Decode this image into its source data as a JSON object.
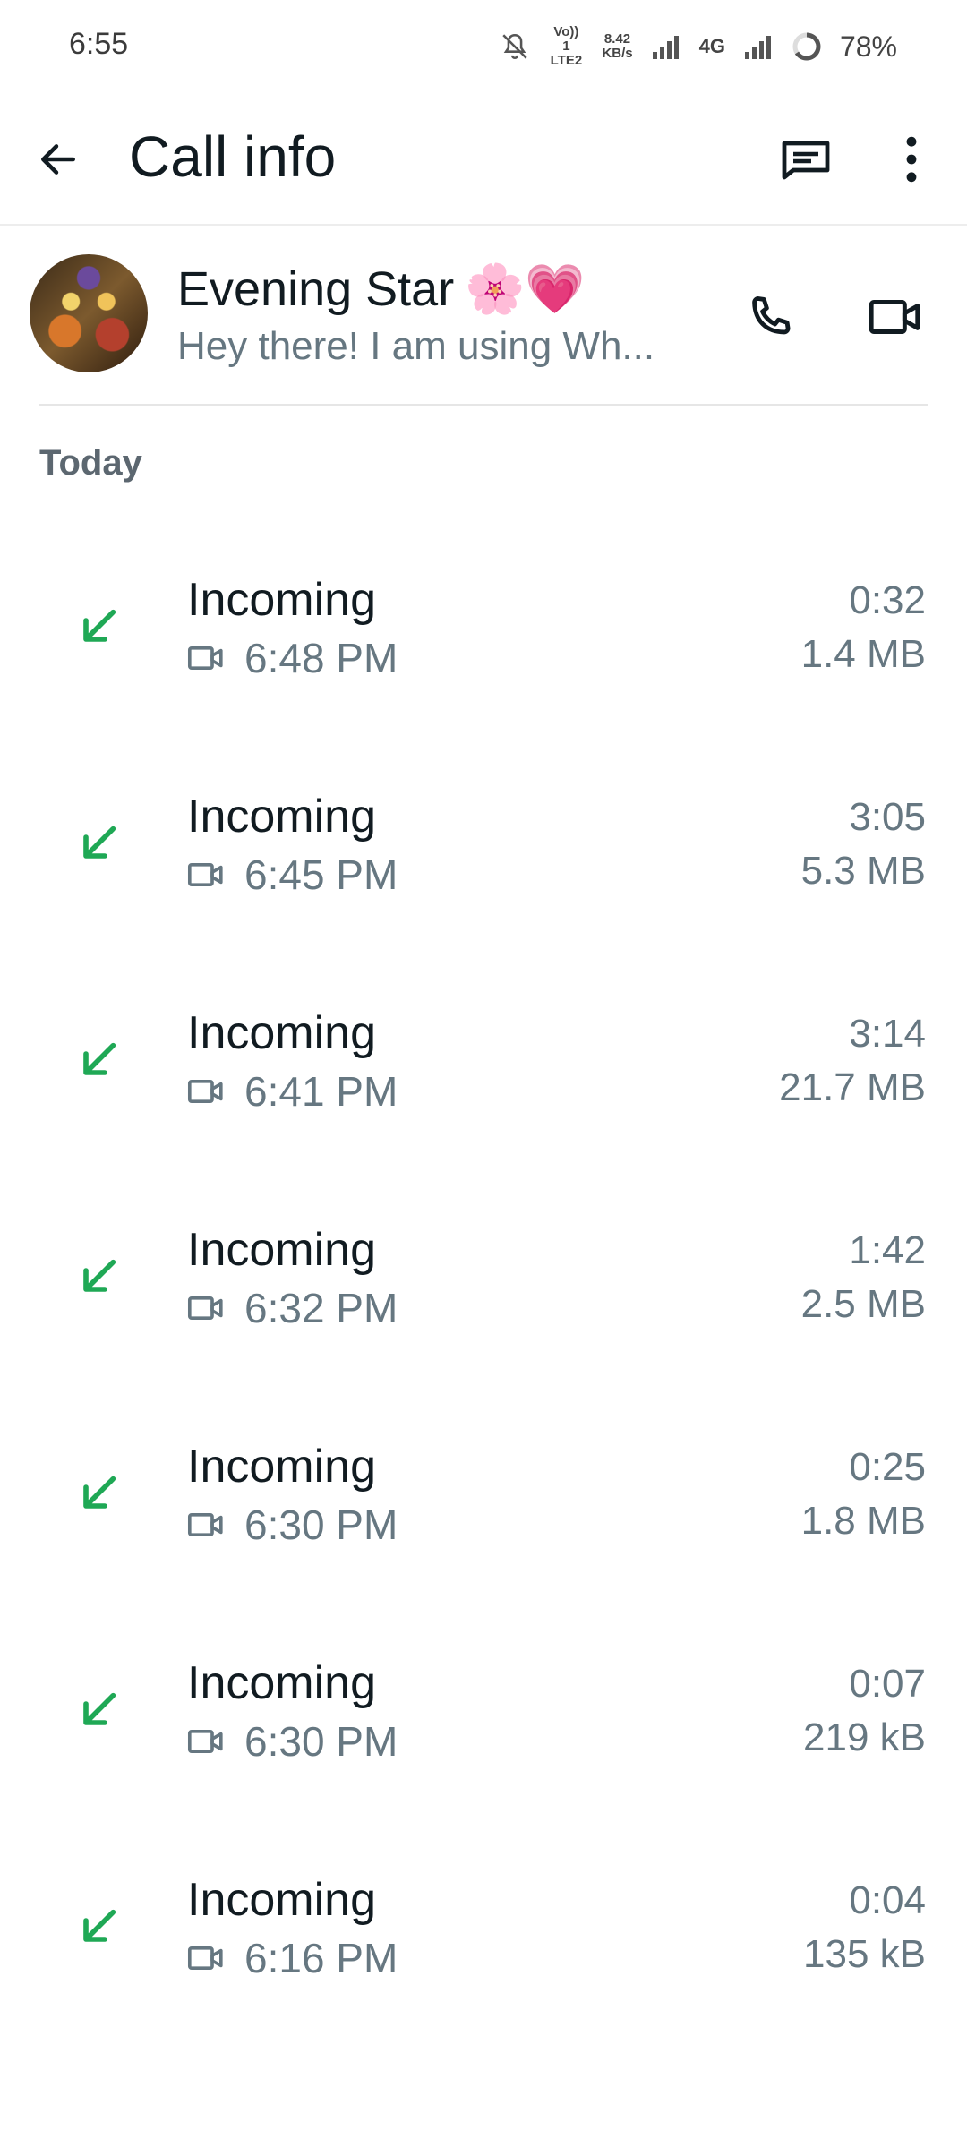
{
  "status_bar": {
    "time": "6:55",
    "volte_label": "Vo)) 1 LTE2",
    "speed_value": "8.42",
    "speed_unit": "KB/s",
    "network": "4G",
    "battery": "78%"
  },
  "app_bar": {
    "title": "Call info"
  },
  "contact": {
    "name": "Evening Star",
    "emoji": "🌸💗",
    "status": "Hey there! I am using Wh..."
  },
  "section": {
    "title": "Today"
  },
  "colors": {
    "accent_green": "#1fa855",
    "text_primary": "#111b21",
    "text_secondary": "#667781"
  },
  "calls": [
    {
      "type": "Incoming",
      "time": "6:48 PM",
      "duration": "0:32",
      "size": "1.4 MB"
    },
    {
      "type": "Incoming",
      "time": "6:45 PM",
      "duration": "3:05",
      "size": "5.3 MB"
    },
    {
      "type": "Incoming",
      "time": "6:41 PM",
      "duration": "3:14",
      "size": "21.7 MB"
    },
    {
      "type": "Incoming",
      "time": "6:32 PM",
      "duration": "1:42",
      "size": "2.5 MB"
    },
    {
      "type": "Incoming",
      "time": "6:30 PM",
      "duration": "0:25",
      "size": "1.8 MB"
    },
    {
      "type": "Incoming",
      "time": "6:30 PM",
      "duration": "0:07",
      "size": "219 kB"
    },
    {
      "type": "Incoming",
      "time": "6:16 PM",
      "duration": "0:04",
      "size": "135 kB"
    }
  ]
}
